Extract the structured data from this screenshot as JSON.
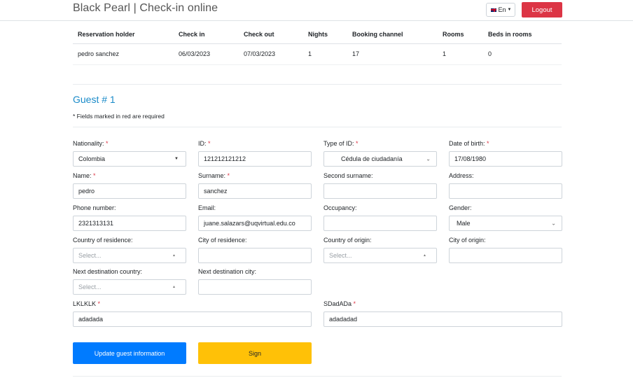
{
  "header": {
    "title": "Black Pearl | Check-in online",
    "language": "En",
    "logout_label": "Logout"
  },
  "reservation": {
    "columns": [
      "Reservation holder",
      "Check in",
      "Check out",
      "Nights",
      "Booking channel",
      "Rooms",
      "Beds in rooms"
    ],
    "row": [
      "pedro sanchez",
      "06/03/2023",
      "07/03/2023",
      "1",
      "17",
      "1",
      "0"
    ]
  },
  "guest": {
    "title": "Guest # 1",
    "required_note": "* Fields marked in red are required",
    "fields": {
      "nationality": {
        "label": "Nationality:",
        "value": "Colombia"
      },
      "id": {
        "label": "ID:",
        "value": "121212121212"
      },
      "type_of_id": {
        "label": "Type of ID:",
        "value": "Cédula de ciudadanía"
      },
      "date_of_birth": {
        "label": "Date of birth:",
        "value": "17/08/1980"
      },
      "name": {
        "label": "Name:",
        "value": "pedro"
      },
      "surname": {
        "label": "Surname:",
        "value": "sanchez"
      },
      "second_surname": {
        "label": "Second surname:",
        "value": ""
      },
      "address": {
        "label": "Address:",
        "value": ""
      },
      "phone": {
        "label": "Phone number:",
        "value": "2321313131"
      },
      "email": {
        "label": "Email:",
        "value": "juane.salazars@uqvirtual.edu.co"
      },
      "occupancy": {
        "label": "Occupancy:",
        "value": ""
      },
      "gender": {
        "label": "Gender:",
        "value": "Male"
      },
      "country_residence": {
        "label": "Country of residence:",
        "placeholder": "Select..."
      },
      "city_residence": {
        "label": "City of residence:",
        "value": ""
      },
      "country_origin": {
        "label": "Country of origin:",
        "placeholder": "Select..."
      },
      "city_origin": {
        "label": "City of origin:",
        "value": ""
      },
      "next_country": {
        "label": "Next destination country:",
        "placeholder": "Select..."
      },
      "next_city": {
        "label": "Next destination city:",
        "value": ""
      },
      "lklklk": {
        "label": "LKLKLK",
        "value": "adadada"
      },
      "sdadada": {
        "label": "SDadADa",
        "value": "adadadad"
      }
    },
    "required_mark": "*"
  },
  "actions": {
    "update_label": "Update guest information",
    "sign_label": "Sign"
  },
  "colors": {
    "accent": "#1a8bc9",
    "primary": "#007bff",
    "warning": "#ffc107",
    "danger": "#dc3545"
  }
}
